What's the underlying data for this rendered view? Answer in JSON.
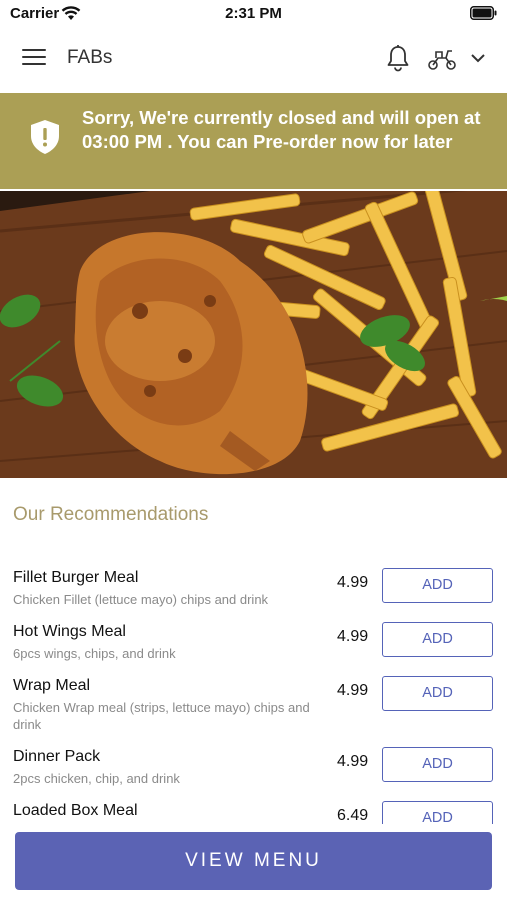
{
  "status_bar": {
    "carrier": "Carrier",
    "time": "2:31 PM"
  },
  "nav": {
    "title": "FABs"
  },
  "banner": {
    "message": "Sorry, We're currently closed and will open at 03:00 PM . You can Pre-order now for later"
  },
  "recommendations": {
    "heading": "Our Recommendations",
    "items": [
      {
        "name": "Fillet Burger Meal",
        "description": "Chicken Fillet (lettuce mayo) chips and drink",
        "price": "4.99",
        "button": "ADD"
      },
      {
        "name": "Hot Wings Meal",
        "description": "6pcs wings, chips, and drink",
        "price": "4.99",
        "button": "ADD"
      },
      {
        "name": "Wrap Meal",
        "description": "Chicken Wrap meal (strips, lettuce mayo) chips and drink",
        "price": "4.99",
        "button": "ADD"
      },
      {
        "name": "Dinner Pack",
        "description": "2pcs chicken, chip, and drink",
        "price": "4.99",
        "button": "ADD"
      },
      {
        "name": "Loaded Box Meal",
        "description": "",
        "price": "6.49",
        "button": "ADD"
      }
    ]
  },
  "footer": {
    "view_menu_label": "VIEW MENU"
  },
  "colors": {
    "banner": "#ab9f55",
    "accent": "#5b63b4",
    "heading": "#a89a6c"
  },
  "icons": [
    "menu-icon",
    "bell-icon",
    "scooter-icon",
    "chevron-down-icon",
    "shield-icon",
    "wifi-icon",
    "battery-icon"
  ]
}
